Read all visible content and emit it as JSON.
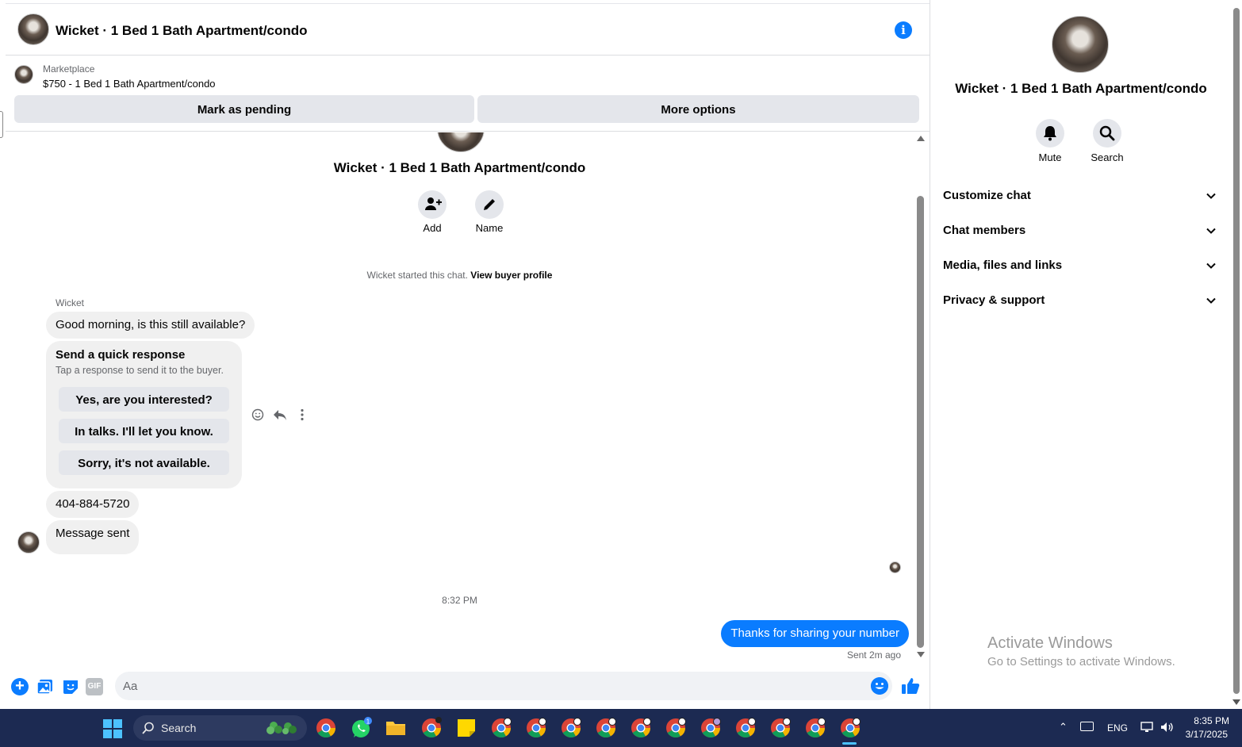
{
  "header": {
    "title": "Wicket · 1 Bed 1 Bath Apartment/condo",
    "info_icon": "info-icon"
  },
  "listing": {
    "source": "Marketplace",
    "title": "$750 - 1 Bed 1 Bath Apartment/condo",
    "mark_pending_label": "Mark as pending",
    "more_options_label": "More options"
  },
  "conversation": {
    "title": "Wicket · 1 Bed 1 Bath Apartment/condo",
    "actions": {
      "add_label": "Add",
      "name_label": "Name"
    },
    "started_text": "Wicket started this chat.",
    "view_profile_label": "View buyer profile",
    "sender_name": "Wicket",
    "messages": {
      "first": "Good morning, is this still available?",
      "quick_title": "Send a quick response",
      "quick_subtitle": "Tap a response to send it to the buyer.",
      "quick_options": [
        "Yes, are you interested?",
        "In talks. I'll let you know.",
        "Sorry, it's not available."
      ],
      "phone": "404-884-5720",
      "sent_notice": "Message sent",
      "timestamp": "8:32 PM",
      "outgoing": "Thanks for sharing your number",
      "outgoing_status": "Sent 2m ago"
    }
  },
  "composer": {
    "placeholder": "Aa",
    "gif_label": "GIF"
  },
  "panel": {
    "title": "Wicket · 1 Bed 1 Bath Apartment/condo",
    "mute_label": "Mute",
    "search_label": "Search",
    "sections": [
      "Customize chat",
      "Chat members",
      "Media, files and links",
      "Privacy & support"
    ]
  },
  "watermark": {
    "title": "Activate Windows",
    "subtitle": "Go to Settings to activate Windows."
  },
  "taskbar": {
    "search_label": "Search",
    "whatsapp_badge": "1",
    "language": "ENG",
    "time": "8:35 PM",
    "date": "3/17/2025"
  },
  "colors": {
    "accent": "#0a7cff",
    "bubble_in": "#f0f0f0",
    "button_gray": "#e4e6eb",
    "taskbar": "#1c2a52"
  }
}
